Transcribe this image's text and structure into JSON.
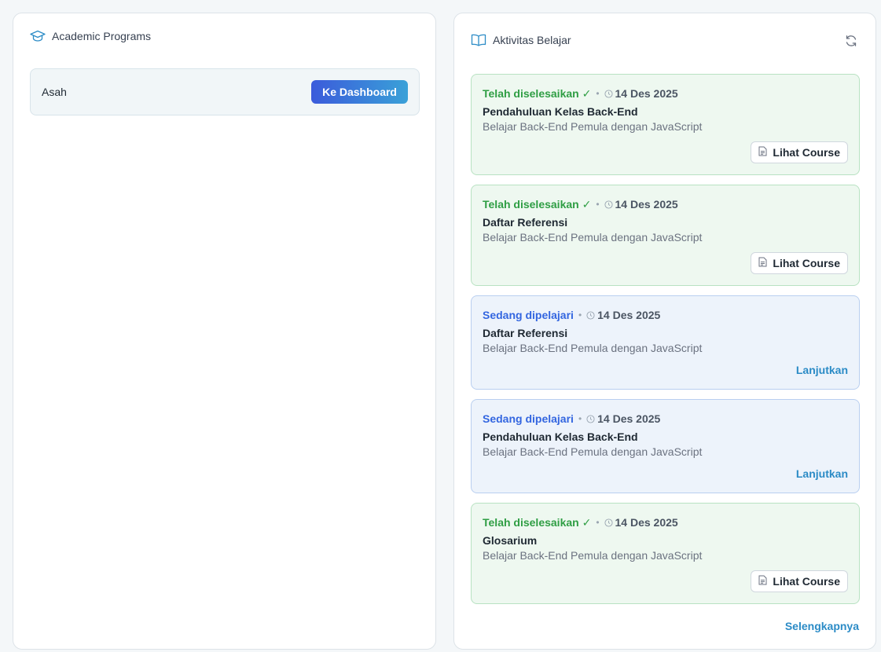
{
  "academic": {
    "title": "Academic Programs",
    "programs": [
      {
        "name": "Asah",
        "button_label": "Ke Dashboard"
      }
    ]
  },
  "activity": {
    "title": "Aktivitas Belajar",
    "items": [
      {
        "status": "Telah diselesaikan ✓",
        "state": "done",
        "date": "14 Des 2025",
        "title": "Pendahuluan Kelas Back-End",
        "course": "Belajar Back-End Pemula dengan JavaScript",
        "action": "Lihat Course"
      },
      {
        "status": "Telah diselesaikan ✓",
        "state": "done",
        "date": "14 Des 2025",
        "title": "Daftar Referensi",
        "course": "Belajar Back-End Pemula dengan JavaScript",
        "action": "Lihat Course"
      },
      {
        "status": "Sedang dipelajari",
        "state": "progress",
        "date": "14 Des 2025",
        "title": "Daftar Referensi",
        "course": "Belajar Back-End Pemula dengan JavaScript",
        "action": "Lanjutkan"
      },
      {
        "status": "Sedang dipelajari",
        "state": "progress",
        "date": "14 Des 2025",
        "title": "Pendahuluan Kelas Back-End",
        "course": "Belajar Back-End Pemula dengan JavaScript",
        "action": "Lanjutkan"
      },
      {
        "status": "Telah diselesaikan ✓",
        "state": "done",
        "date": "14 Des 2025",
        "title": "Glosarium",
        "course": "Belajar Back-End Pemula dengan JavaScript",
        "action": "Lihat Course"
      }
    ],
    "more_label": "Selengkapnya"
  },
  "colors": {
    "accent": "#2b8bc6",
    "done": "#2f9e44",
    "progress": "#3366e0"
  },
  "icons": {
    "academic": "graduation-cap-icon",
    "activity": "book-open-icon",
    "refresh": "refresh-icon",
    "clock": "clock-icon",
    "document": "document-icon"
  }
}
